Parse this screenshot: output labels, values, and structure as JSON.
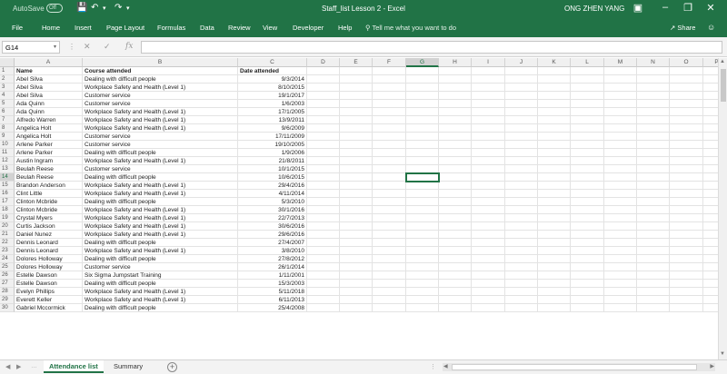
{
  "titlebar": {
    "autosave": "AutoSave",
    "autosave_toggle": "Off",
    "doc_title": "Staff_list Lesson 2 - Excel",
    "user": "ONG ZHEN YANG"
  },
  "ribbon": {
    "tabs": [
      "File",
      "Home",
      "Insert",
      "Page Layout",
      "Formulas",
      "Data",
      "Review",
      "View",
      "Developer",
      "Help"
    ],
    "tell_me": "Tell me what you want to do",
    "share": "Share"
  },
  "formula_bar": {
    "name_box": "G14",
    "fx": "fx",
    "content": ""
  },
  "columns": [
    "A",
    "B",
    "C",
    "D",
    "E",
    "F",
    "G",
    "H",
    "I",
    "J",
    "K",
    "L",
    "M",
    "N",
    "O",
    "P"
  ],
  "selected_cell": "G14",
  "rows": [
    {
      "n": "1",
      "a": "Name",
      "b": "Course attended",
      "c": "Date attended"
    },
    {
      "n": "2",
      "a": "Abel Silva",
      "b": "Dealing with difficult people",
      "c": "9/3/2014"
    },
    {
      "n": "3",
      "a": "Abel Silva",
      "b": "Workplace Safety and Health (Level 1)",
      "c": "8/10/2015"
    },
    {
      "n": "4",
      "a": "Abel Silva",
      "b": "Customer service",
      "c": "19/1/2017"
    },
    {
      "n": "5",
      "a": "Ada Quinn",
      "b": "Customer service",
      "c": "1/6/2003"
    },
    {
      "n": "6",
      "a": "Ada Quinn",
      "b": "Workplace Safety and Health (Level 1)",
      "c": "17/1/2005"
    },
    {
      "n": "7",
      "a": "Alfredo Warren",
      "b": "Workplace Safety and Health (Level 1)",
      "c": "13/9/2011"
    },
    {
      "n": "8",
      "a": "Angelica Holt",
      "b": "Workplace Safety and Health (Level 1)",
      "c": "9/6/2009"
    },
    {
      "n": "9",
      "a": "Angelica Holt",
      "b": "Customer service",
      "c": "17/11/2009"
    },
    {
      "n": "10",
      "a": "Arlene Parker",
      "b": "Customer service",
      "c": "19/10/2005"
    },
    {
      "n": "11",
      "a": "Arlene Parker",
      "b": "Dealing with difficult people",
      "c": "1/9/2006"
    },
    {
      "n": "12",
      "a": "Austin Ingram",
      "b": "Workplace Safety and Health (Level 1)",
      "c": "21/8/2011"
    },
    {
      "n": "13",
      "a": "Beulah Reese",
      "b": "Customer service",
      "c": "10/1/2015"
    },
    {
      "n": "14",
      "a": "Beulah Reese",
      "b": "Dealing with difficult people",
      "c": "10/6/2015"
    },
    {
      "n": "15",
      "a": "Brandon Anderson",
      "b": "Workplace Safety and Health (Level 1)",
      "c": "29/4/2016"
    },
    {
      "n": "16",
      "a": "Clint Little",
      "b": "Workplace Safety and Health (Level 1)",
      "c": "4/11/2014"
    },
    {
      "n": "17",
      "a": "Clinton Mcbride",
      "b": "Dealing with difficult people",
      "c": "5/3/2010"
    },
    {
      "n": "18",
      "a": "Clinton Mcbride",
      "b": "Workplace Safety and Health (Level 1)",
      "c": "30/1/2016"
    },
    {
      "n": "19",
      "a": "Crystal Myers",
      "b": "Workplace Safety and Health (Level 1)",
      "c": "22/7/2013"
    },
    {
      "n": "20",
      "a": "Curtis Jackson",
      "b": "Workplace Safety and Health (Level 1)",
      "c": "30/6/2016"
    },
    {
      "n": "21",
      "a": "Daniel Nunez",
      "b": "Workplace Safety and Health (Level 1)",
      "c": "29/6/2016"
    },
    {
      "n": "22",
      "a": "Dennis Leonard",
      "b": "Dealing with difficult people",
      "c": "27/4/2007"
    },
    {
      "n": "23",
      "a": "Dennis Leonard",
      "b": "Workplace Safety and Health (Level 1)",
      "c": "3/8/2010"
    },
    {
      "n": "24",
      "a": "Dolores Holloway",
      "b": "Dealing with difficult people",
      "c": "27/8/2012"
    },
    {
      "n": "25",
      "a": "Dolores Holloway",
      "b": "Customer service",
      "c": "26/1/2014"
    },
    {
      "n": "26",
      "a": "Estelle Dawson",
      "b": "Six Sigma Jumpstart Training",
      "c": "1/11/2001"
    },
    {
      "n": "27",
      "a": "Estelle Dawson",
      "b": "Dealing with difficult people",
      "c": "15/3/2003"
    },
    {
      "n": "28",
      "a": "Evelyn Phillips",
      "b": "Workplace Safety and Health (Level 1)",
      "c": "5/11/2018"
    },
    {
      "n": "29",
      "a": "Everett Keller",
      "b": "Workplace Safety and Health (Level 1)",
      "c": "6/11/2013"
    },
    {
      "n": "30",
      "a": "Gabriel Mccormick",
      "b": "Dealing with difficult people",
      "c": "25/4/2008"
    }
  ],
  "sheets": [
    "Attendance list",
    "Summary"
  ],
  "add_sheet": "+"
}
